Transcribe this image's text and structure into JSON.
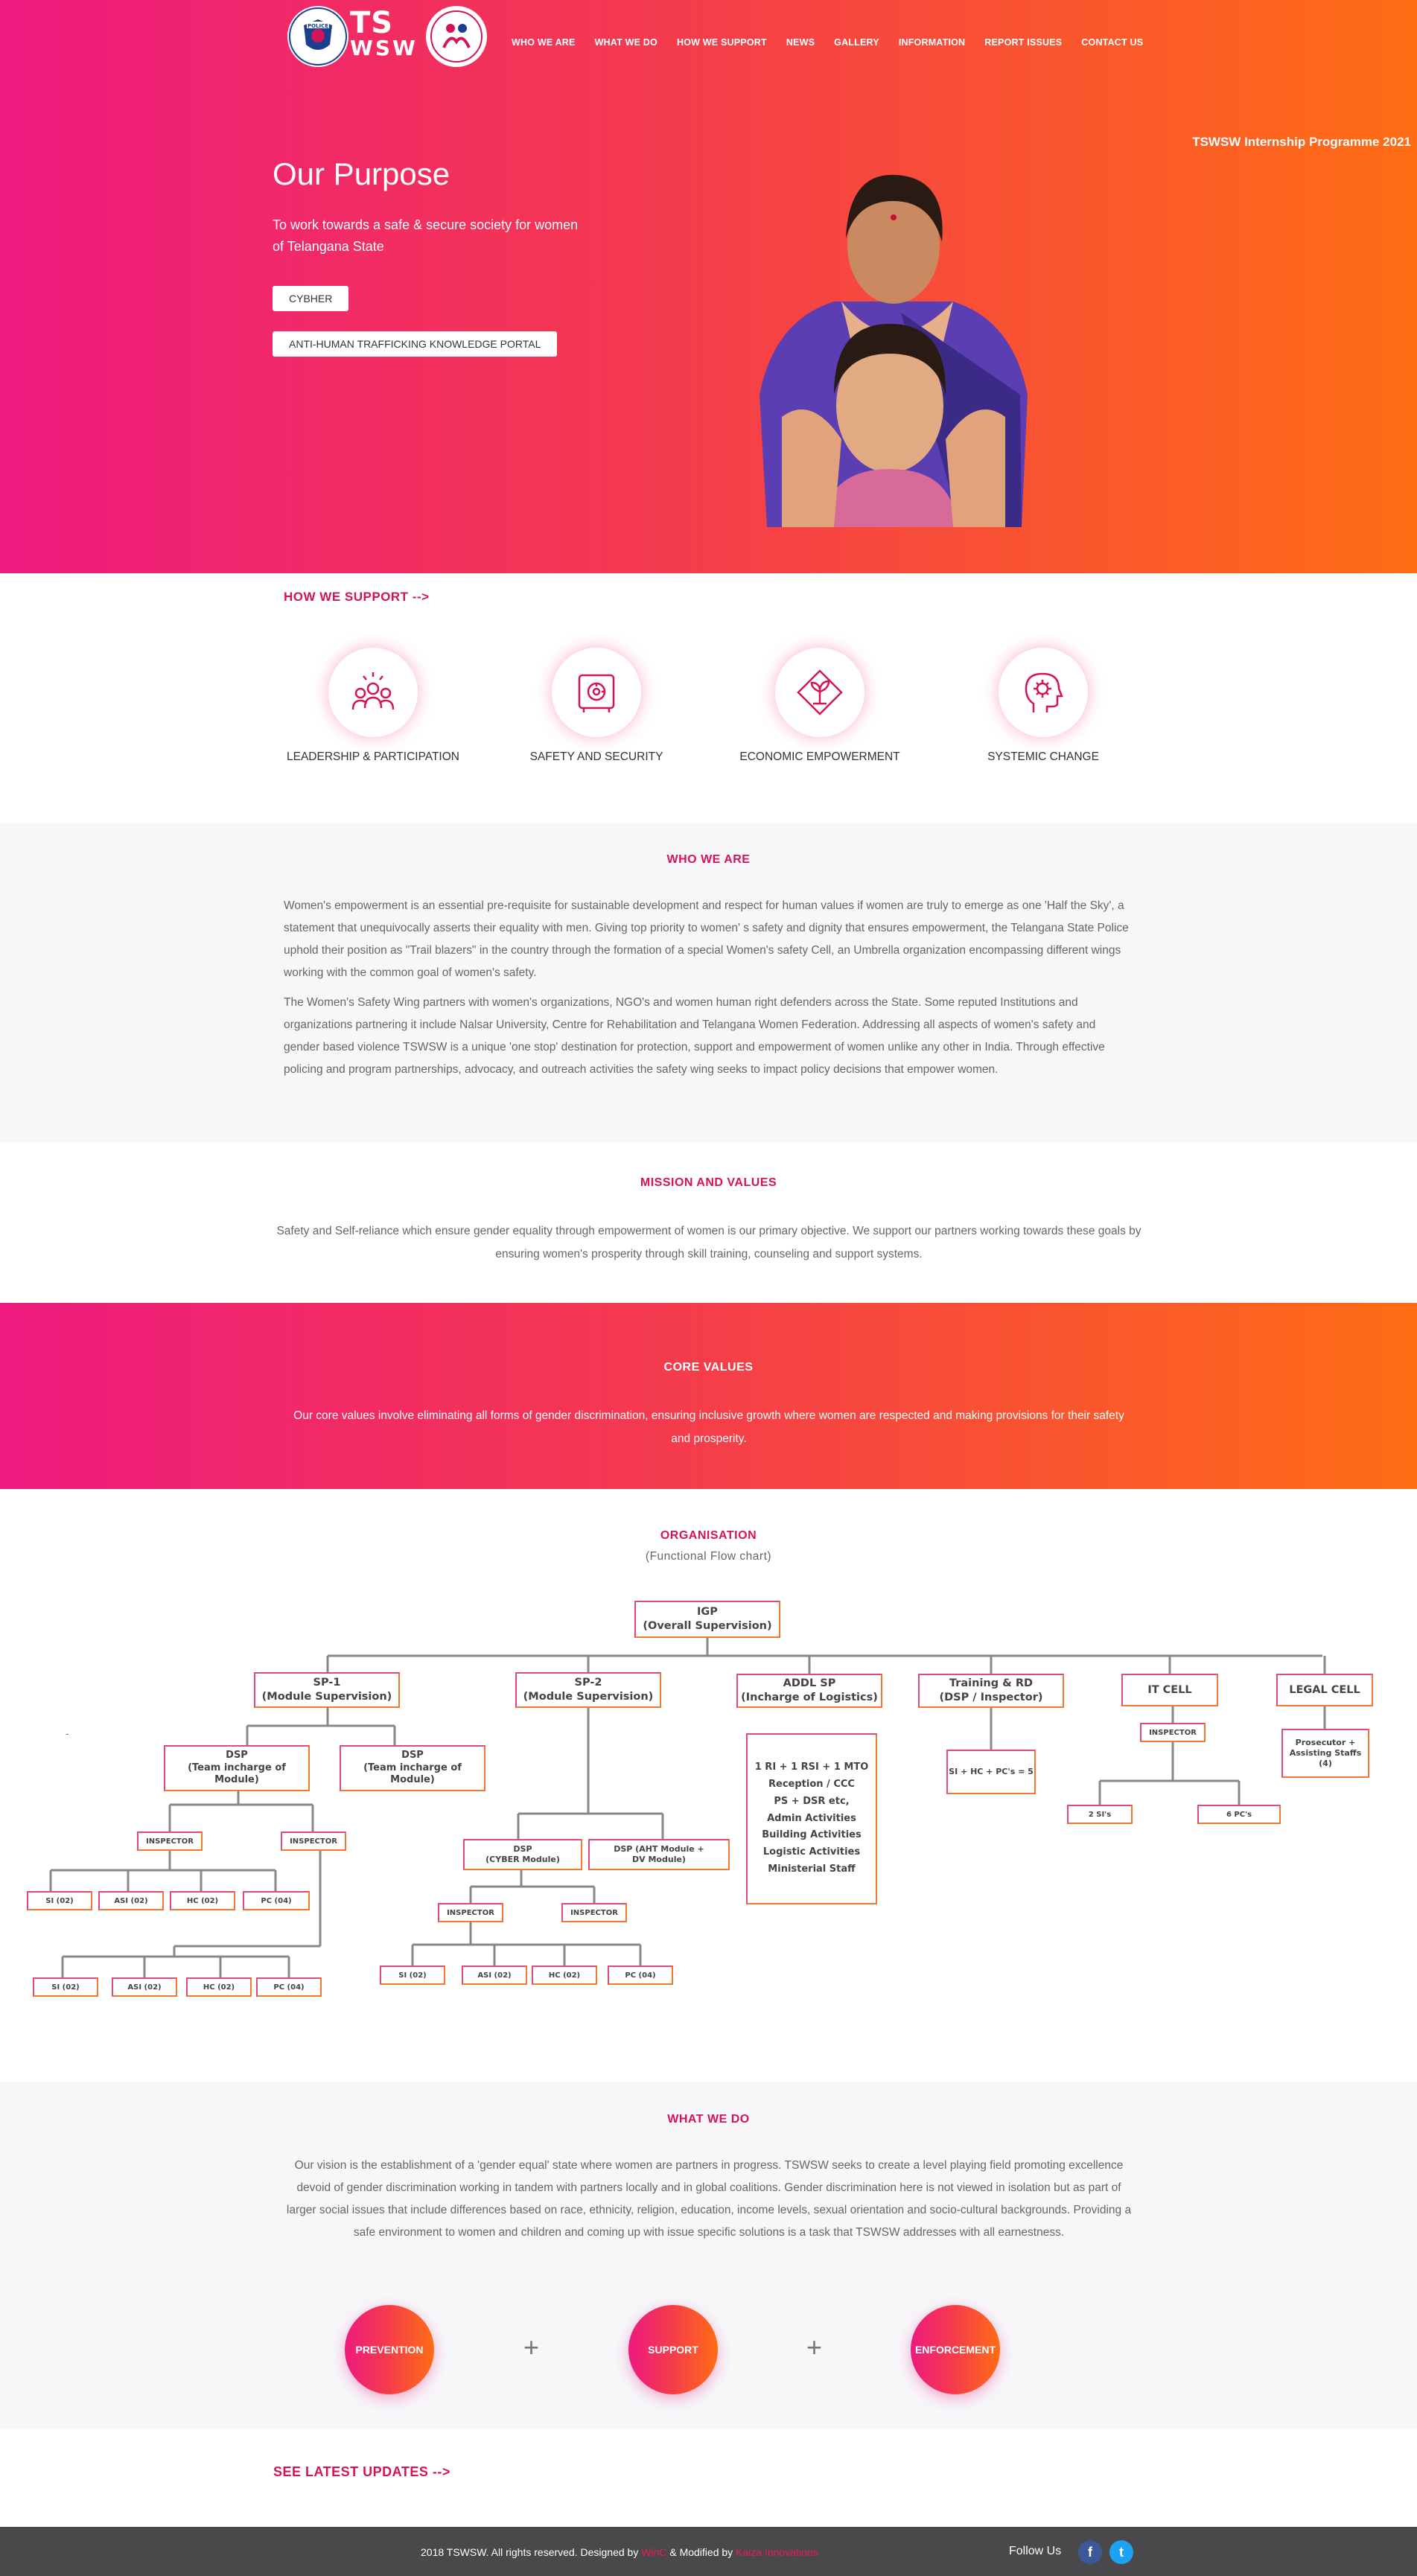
{
  "brand": {
    "logo_text": "TS WSW",
    "logo_line1": "TS",
    "logo_line2": "WSW",
    "police_badge": "POLICE"
  },
  "nav": [
    "WHO WE ARE",
    "WHAT WE DO",
    "HOW WE SUPPORT",
    "NEWS",
    "GALLERY",
    "INFORMATION",
    "REPORT ISSUES",
    "CONTACT US"
  ],
  "hero": {
    "internship": "TSWSW Internship Programme 2021",
    "title": "Our Purpose",
    "subtitle": "To work towards a safe & secure society for women of Telangana State",
    "btn_cyber": "CYBHER",
    "btn_portal": "ANTI-HUMAN TRAFFICKING KNOWLEDGE PORTAL"
  },
  "support": {
    "link": "HOW WE SUPPORT -->",
    "items": [
      {
        "label": "LEADERSHIP & PARTICIPATION",
        "icon": "team-icon"
      },
      {
        "label": "SAFETY AND SECURITY",
        "icon": "safe-icon"
      },
      {
        "label": "ECONOMIC EMPOWERMENT",
        "icon": "growth-icon"
      },
      {
        "label": "SYSTEMIC CHANGE",
        "icon": "head-gear-icon"
      }
    ]
  },
  "who": {
    "title": "WHO WE ARE",
    "p1": "Women's empowerment is an essential pre-requisite for sustainable development and respect for human values if women are truly to emerge as one 'Half the Sky', a statement that unequivocally asserts their equality with men. Giving top priority to women' s safety and dignity that ensures empowerment, the Telangana State Police uphold their position as \"Trail blazers\" in the country through the formation of a special Women's safety Cell, an Umbrella organization encompassing different wings working with the common goal of women's safety.",
    "p2": "The Women's Safety Wing partners with women's organizations, NGO's and women human right defenders across the State. Some reputed Institutions and organizations partnering it include Nalsar University, Centre for Rehabilitation and Telangana Women Federation. Addressing all aspects of women's safety and gender based violence TSWSW is a unique 'one stop' destination for protection, support and empowerment of women unlike any other in India. Through effective policing and program partnerships, advocacy, and outreach activities the safety wing seeks to impact policy decisions that empower women."
  },
  "mission": {
    "title": "MISSION AND VALUES",
    "text": "Safety and Self-reliance which ensure gender equality through empowerment of women is our primary objective. We support our partners working towards these goals by ensuring women's prosperity through skill training, counseling and support systems."
  },
  "core": {
    "title": "CORE VALUES",
    "text": "Our core values involve eliminating all forms of gender discrimination, ensuring inclusive growth where women are respected and making provisions for their safety and prosperity."
  },
  "org": {
    "title": "ORGANISATION",
    "subtitle": "(Functional Flow chart)",
    "dash": "-",
    "igp": "IGP\n(Overall Supervision)",
    "sp1": "SP-1\n(Module Supervision)",
    "sp2": "SP-2\n(Module Supervision)",
    "addl": "ADDL SP\n(Incharge of Logistics)",
    "training": "Training & RD\n(DSP / Inspector)",
    "itcell": "IT CELL",
    "legal": "LEGAL CELL",
    "dsp_a": "DSP\n(Team incharge of\nModule)",
    "dsp_b": "DSP\n(Team incharge of\nModule)",
    "dsp_cyber": "DSP\n(CYBER Module)",
    "dsp_aht": "DSP (AHT Module +\nDV Module)",
    "logistics": "1 RI + 1 RSI + 1 MTO\nReception / CCC\nPS + DSR etc,\nAdmin Activities\nBuilding Activities\nLogistic Activities\nMinisterial Staff",
    "training_staff": "SI + HC + PC's = 5",
    "inspector": "INSPECTOR",
    "si_2": "2 SI's",
    "pc_6": "6 PC's",
    "prosecutor": "Prosecutor +\nAssisting Staffs\n(4)",
    "si": "SI (02)",
    "asi": "ASI (02)",
    "hc": "HC (02)",
    "pc": "PC (04)"
  },
  "what": {
    "title": "WHAT WE DO",
    "text": "Our vision is the establishment of a 'gender equal' state where women are partners in progress. TSWSW seeks to create a level playing field promoting excellence devoid of gender discrimination working in tandem with partners locally and in global coalitions. Gender discrimination here is not viewed in isolation but as part of larger social issues that include differences based on race, ethnicity, religion, education, income levels, sexual orientation and socio-cultural backgrounds. Providing a safe environment to women and children and coming up with issue specific solutions is a task that TSWSW addresses with all earnestness.",
    "pillars": [
      "PREVENTION",
      "SUPPORT",
      "ENFORCEMENT"
    ],
    "plus": "+"
  },
  "latest": {
    "link": "SEE LATEST UPDATES -->"
  },
  "footer": {
    "prefix": "2018 TSWSW. All rights reserved. Designed by",
    "designer": "WinC",
    "mid": "& Modified by",
    "modifier": "Kaiza Innovations",
    "follow": "Follow Us",
    "fb": "f",
    "tw": "t"
  },
  "colors": {
    "accent_pink": "#ee1a7f",
    "accent_orange": "#ff6d14",
    "title_red": "#d4145a",
    "footer_bg": "#49494b"
  }
}
